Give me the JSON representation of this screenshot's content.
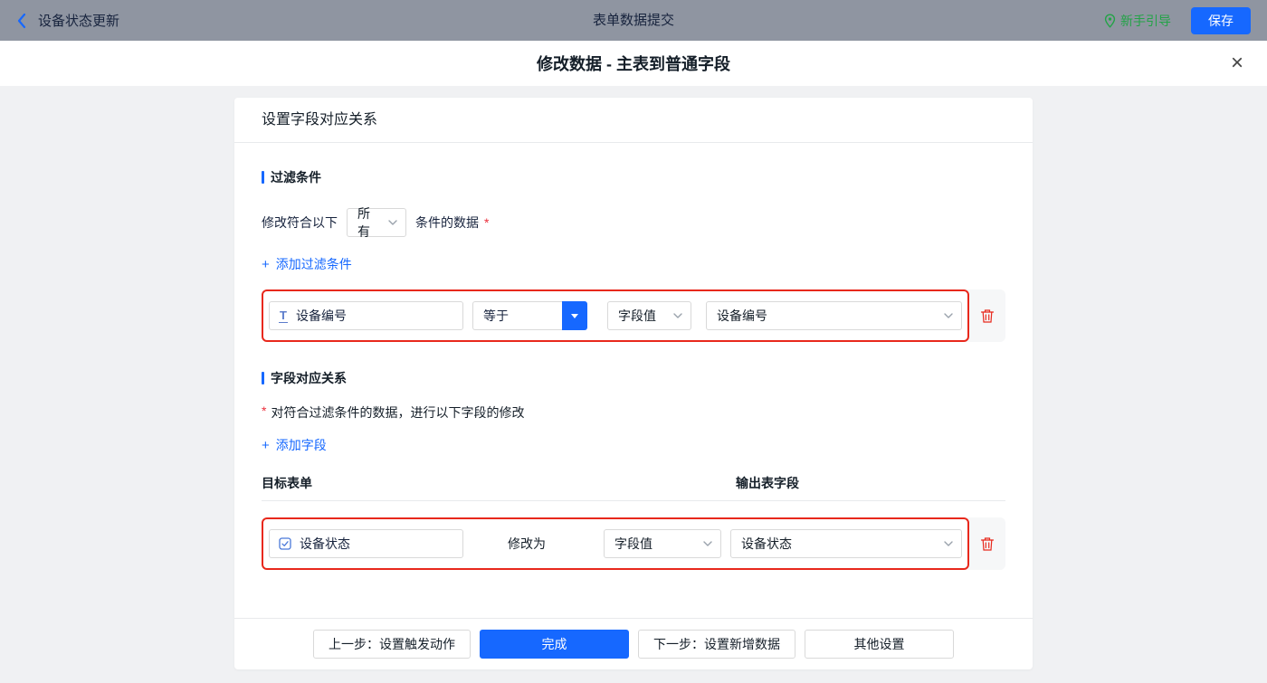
{
  "topbar": {
    "flow_title": "设备状态更新",
    "center_title": "表单数据提交",
    "guide_label": "新手引导",
    "save_label": "保存"
  },
  "dialog": {
    "title": "修改数据 - 主表到普通字段",
    "close_glyph": "×"
  },
  "panel": {
    "header": "设置字段对应关系"
  },
  "filter": {
    "section_title": "过滤条件",
    "prefix": "修改符合以下",
    "scope_value": "所有",
    "suffix": "条件的数据",
    "required_mark": "*",
    "add_plus": "+",
    "add_label": "添加过滤条件",
    "row": {
      "field_icon_glyph": "T",
      "field": "设备编号",
      "operator": "等于",
      "value_type": "字段值",
      "value": "设备编号"
    }
  },
  "mapping": {
    "section_title": "字段对应关系",
    "required_mark": "*",
    "description": "对符合过滤条件的数据，进行以下字段的修改",
    "add_plus": "+",
    "add_label": "添加字段",
    "col_target": "目标表单",
    "col_output": "输出表字段",
    "row": {
      "field": "设备状态",
      "action_label": "修改为",
      "value_type": "字段值",
      "value": "设备状态"
    }
  },
  "footer": {
    "prev_label": "上一步：设置触发动作",
    "done_label": "完成",
    "next_label": "下一步：设置新增数据",
    "other_label": "其他设置"
  },
  "colors": {
    "accent_blue": "#1668ff",
    "highlight_red": "#e8281c",
    "guide_green": "#23a347",
    "topbar_bg": "#8f95a1"
  }
}
